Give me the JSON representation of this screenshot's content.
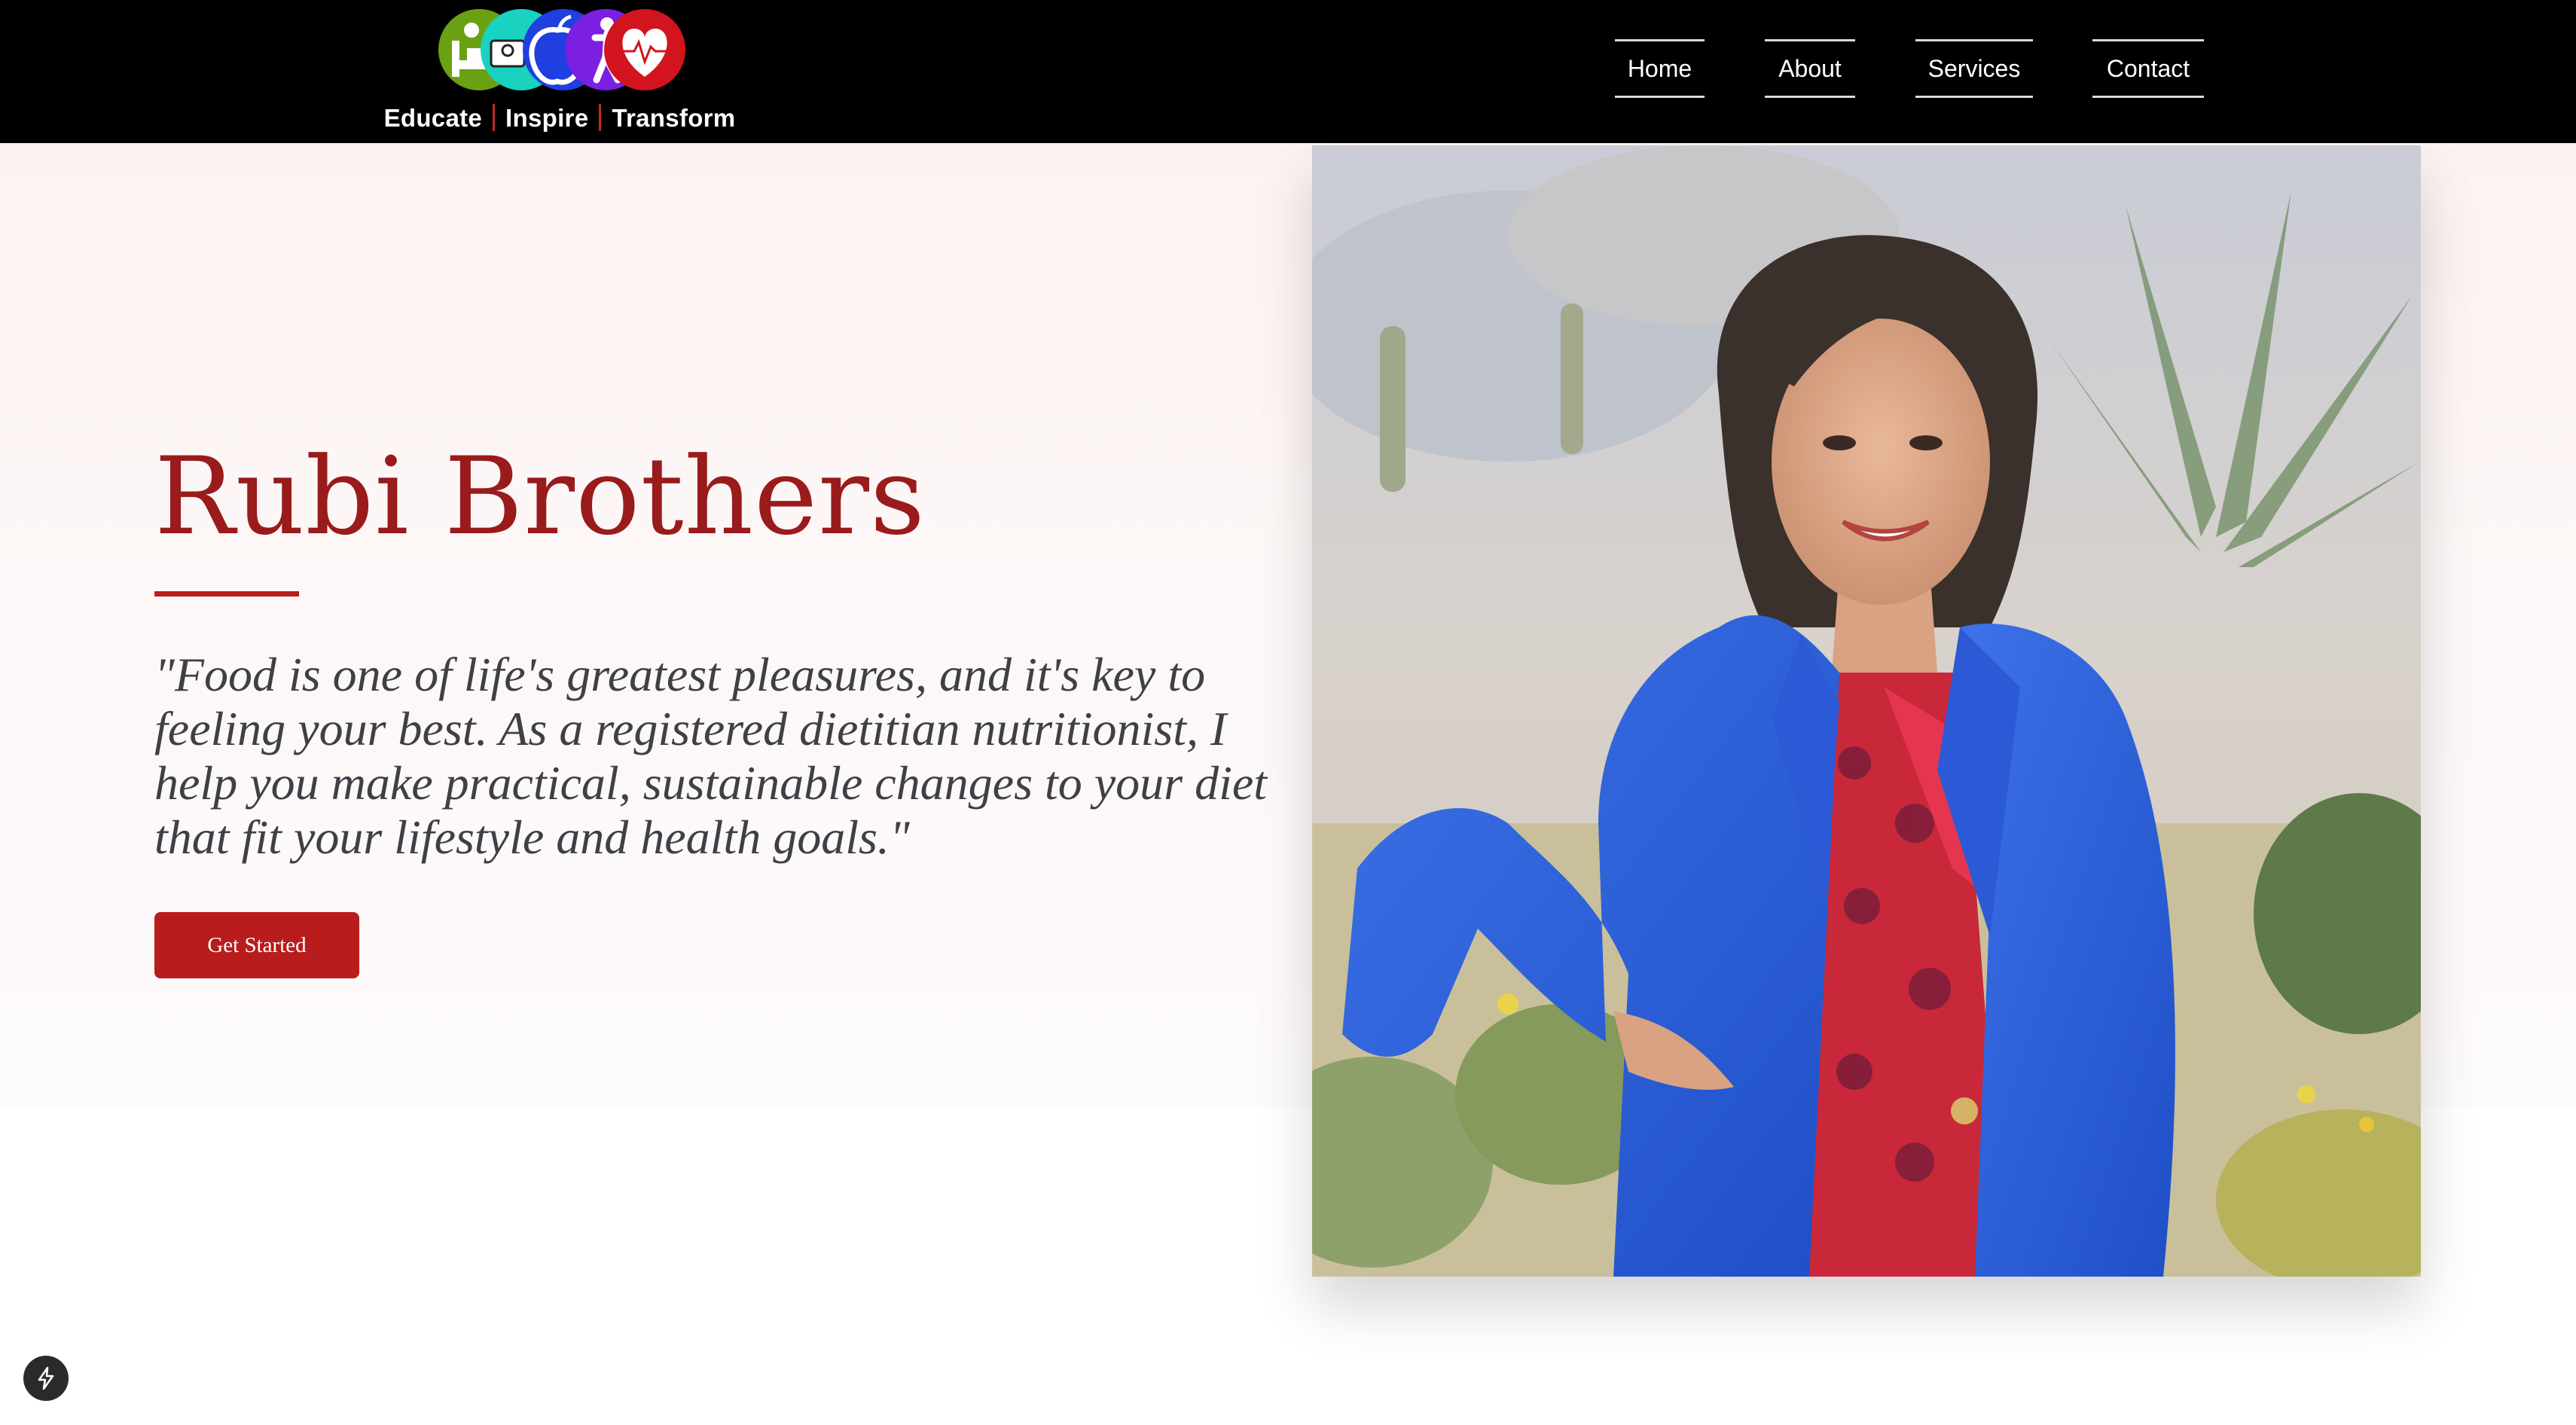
{
  "header": {
    "logo": {
      "icons": [
        "bed-icon",
        "scale-icon",
        "apple-icon",
        "stretch-figure-icon",
        "heart-pulse-icon"
      ],
      "icon_colors": [
        "#6aa112",
        "#19d2c0",
        "#1f3fe0",
        "#7b1fe0",
        "#d1141d"
      ],
      "tagline": [
        "Educate",
        "Inspire",
        "Transform"
      ],
      "separator_color": "#c62828"
    },
    "nav": [
      {
        "label": "Home"
      },
      {
        "label": "About"
      },
      {
        "label": "Services"
      },
      {
        "label": "Contact"
      }
    ]
  },
  "hero": {
    "title": "Rubi Brothers",
    "quote": "\"Food is one of life's greatest pleasures, and it's key to feeling your best. As a registered dietitian nutritionist, I help you make practical, sustainable changes to your diet that fit your lifestyle and health goals.\"",
    "cta_label": "Get Started",
    "photo_icon": "portrait-photo",
    "colors": {
      "accent": "#991b1b",
      "button": "#b91c1c",
      "background": "#fcf4f3",
      "header": "#000000"
    }
  },
  "badge": {
    "icon": "bolt-icon",
    "color": "#2a2a2a"
  }
}
